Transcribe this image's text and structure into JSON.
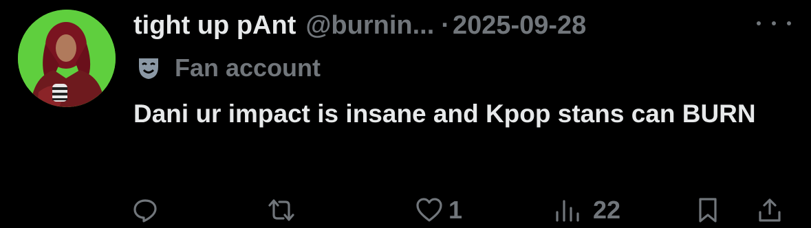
{
  "post": {
    "display_name": "tight up pAnt",
    "handle": "@burnin...",
    "separator": "·",
    "date": "2025-09-28",
    "label": "Fan account",
    "text": "Dani ur impact is insane and Kpop stans can BURN"
  },
  "icons": {
    "avatar": "avatar",
    "more": "more-icon",
    "label": "theater-masks-icon",
    "reply": "reply-icon",
    "repost": "repost-icon",
    "like": "heart-icon",
    "views": "views-icon",
    "bookmark": "bookmark-icon",
    "share": "share-icon"
  },
  "actions": {
    "reply_count": "",
    "repost_count": "",
    "like_count": "1",
    "views_count": "22"
  },
  "colors": {
    "background": "#000000",
    "primary_text": "#e7e9ea",
    "secondary_text": "#71767b",
    "avatar_bg": "#5fcf3e"
  }
}
